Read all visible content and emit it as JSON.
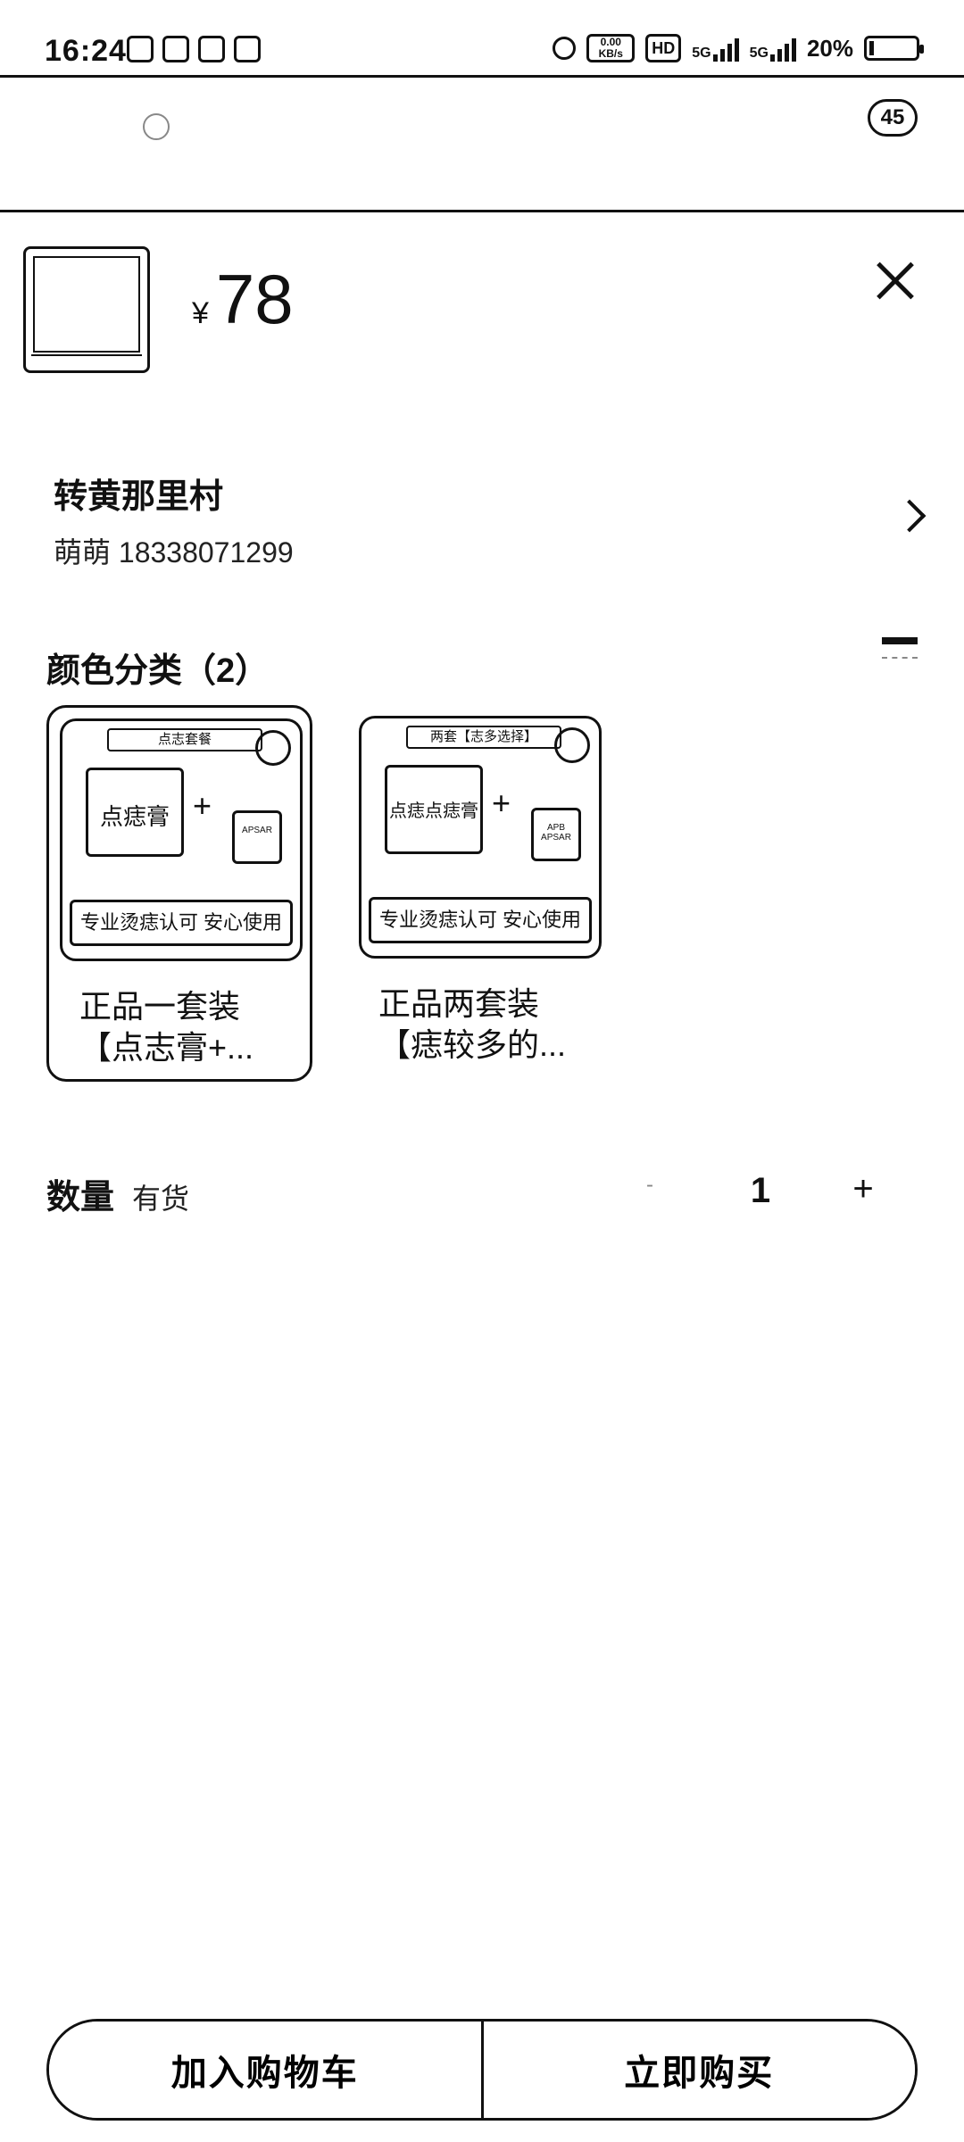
{
  "status_bar": {
    "time": "16:24",
    "net_speed": "0.00 KB/s",
    "hd_label": "HD",
    "network1": "5G",
    "network2": "5G",
    "battery_percent": "20%",
    "battery_level": 0.2
  },
  "background_page": {
    "badge_count": "45"
  },
  "product": {
    "currency_symbol": "¥",
    "price": "78"
  },
  "address": {
    "name": "转黄那里村",
    "contact": "萌萌 18338071299"
  },
  "variants_section": {
    "title": "颜色分类（2）",
    "items": [
      {
        "name": "正品一套装【点志膏+...",
        "banner": "点志套餐",
        "jar_label": "点痣膏",
        "footer": "专业烫痣认可 安心使用",
        "selected": true
      },
      {
        "name": "正品两套装【痣较多的...",
        "banner": "两套【志多选择】",
        "jar_label": "点痣点痣膏",
        "footer": "专业烫痣认可 安心使用",
        "selected": false
      }
    ]
  },
  "quantity": {
    "label": "数量",
    "stock": "有货",
    "value": "1",
    "minus": "-",
    "plus": "+"
  },
  "actions": {
    "add_to_cart": "加入购物车",
    "buy_now": "立即购买"
  }
}
